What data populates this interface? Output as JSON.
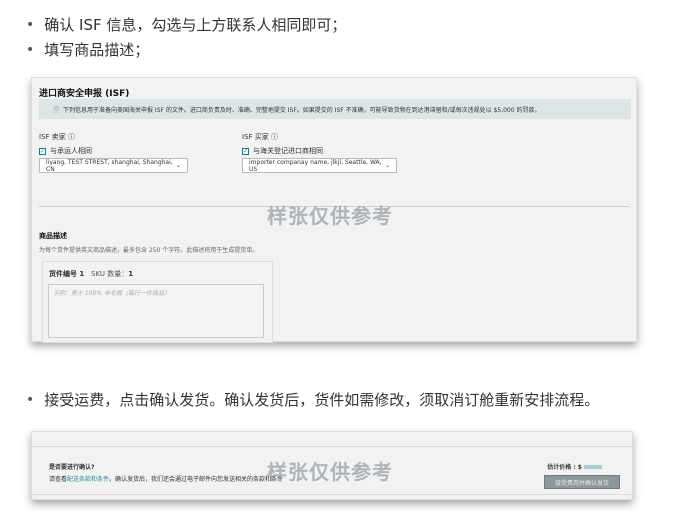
{
  "bullets": [
    "确认 ISF 信息，勾选与上方联系人相同即可；",
    "填写商品描述；",
    "接受运费，点击确认发货。确认发货后，货件如需修改，须取消订舱重新安排流程。"
  ],
  "isf": {
    "title": "进口商安全申报 (ISF)",
    "info": "下列信息用于准备向美国海关申报 ISF 的文件。进口商负责及时、准确、完整地提交 ISF。如果提交的 ISF 不准确，可能导致货物在到达港滞留和/或每次违规处以 $5,000 的罚款。",
    "seller_label": "ISF 卖家",
    "seller_checkbox": "与承运人相同",
    "seller_value": "liyang, TEST STREST, shanghai, Shanghai, CN",
    "buyer_label": "ISF 买家",
    "buyer_checkbox": "与海关登记进口商相同",
    "buyer_value": "importer companay name, jlkjl, Seattle, WA, US"
  },
  "desc": {
    "title": "商品描述",
    "hint": "为每个货件提供英文商品描述，最多包含 250 个字符。此描述将用于生成提货单。",
    "shipment_label": "货件编号 1",
    "sku_label": "SKU 数量：",
    "sku_value": "1",
    "placeholder": "示例：男士 100% 羊毛裤（每行一件商品）"
  },
  "confirm": {
    "question": "是否要进行确认?",
    "text_prefix": "请查看",
    "link": "配送条款和条件",
    "text_suffix": "。确认发货后，我们还会通过电子邮件向您发送相关的条款和条件",
    "price_label": "估计价格 : $",
    "button": "接受费用并确认发货"
  },
  "watermark": "样张仅供参考",
  "colors": {
    "accent": "#0a7e8c",
    "button": "#8a9a9c"
  }
}
